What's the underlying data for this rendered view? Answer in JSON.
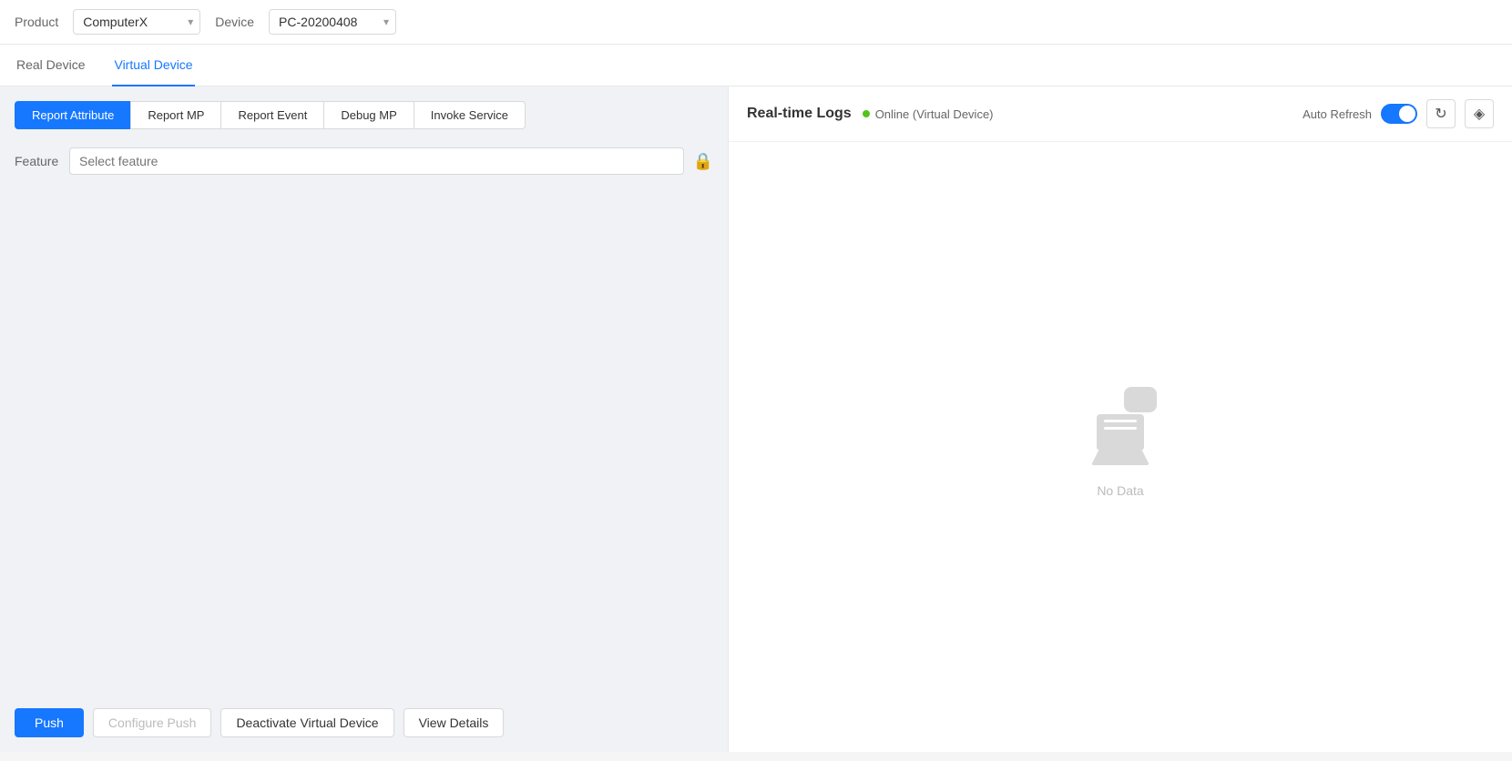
{
  "topBar": {
    "productLabel": "Product",
    "productOptions": [
      "ComputerX"
    ],
    "productSelected": "ComputerX",
    "deviceLabel": "Device",
    "deviceOptions": [
      "PC-20200408"
    ],
    "deviceSelected": "PC-20200408"
  },
  "deviceTabs": {
    "items": [
      {
        "id": "real-device",
        "label": "Real Device",
        "active": false
      },
      {
        "id": "virtual-device",
        "label": "Virtual Device",
        "active": true
      }
    ]
  },
  "leftPanel": {
    "subTabs": [
      {
        "id": "report-attribute",
        "label": "Report Attribute",
        "active": true
      },
      {
        "id": "report-mp",
        "label": "Report MP",
        "active": false
      },
      {
        "id": "report-event",
        "label": "Report Event",
        "active": false
      },
      {
        "id": "debug-mp",
        "label": "Debug MP",
        "active": false
      },
      {
        "id": "invoke-service",
        "label": "Invoke Service",
        "active": false
      }
    ],
    "featureLabel": "Feature",
    "featurePlaceholder": "Select feature",
    "bottomButtons": {
      "push": "Push",
      "configurePush": "Configure Push",
      "deactivate": "Deactivate Virtual Device",
      "viewDetails": "View Details"
    }
  },
  "rightPanel": {
    "logsTitle": "Real-time Logs",
    "onlineLabel": "Online (Virtual Device)",
    "autoRefreshLabel": "Auto Refresh",
    "noDataLabel": "No Data",
    "refreshIcon": "↻",
    "clearIcon": "⊘"
  }
}
